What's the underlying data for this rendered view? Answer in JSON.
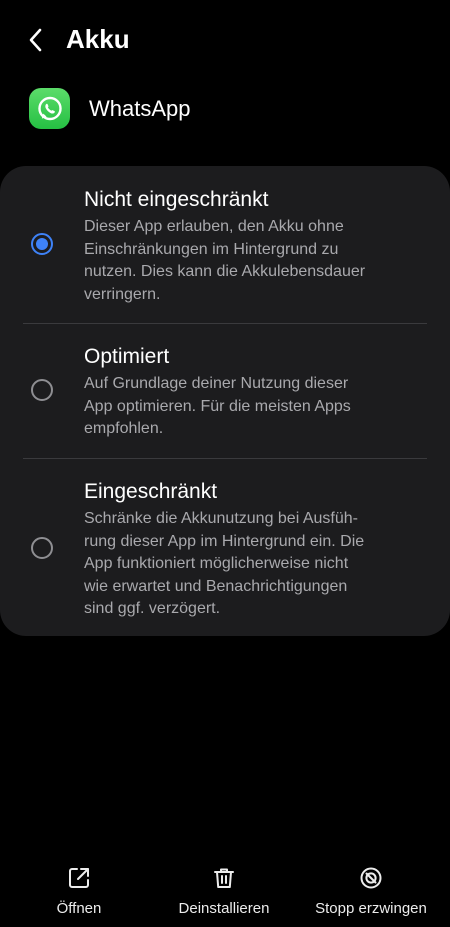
{
  "header": {
    "title": "Akku",
    "back_icon": "chevron-left-icon"
  },
  "app": {
    "name": "WhatsApp",
    "icon": "whatsapp-logo-icon",
    "icon_color": "#25C043"
  },
  "battery_options": [
    {
      "title": "Nicht eingeschränkt",
      "description": [
        "Dieser App erlauben, den Akku ohne",
        "Einschränkungen im Hintergrund zu",
        "nutzen. Dies kann die Akkulebensdauer",
        "verringern."
      ],
      "selected": true
    },
    {
      "title": "Optimiert",
      "description": [
        "Auf Grundlage deiner Nutzung dieser",
        "App optimieren. Für die meisten Apps",
        "empfohlen."
      ],
      "selected": false
    },
    {
      "title": "Eingeschränkt",
      "description": [
        "Schränke die Akkunutzung bei Ausfüh-",
        "rung dieser App im Hintergrund ein. Die",
        "App funktioniert möglicherweise nicht",
        "wie erwartet und Benachrichtigungen",
        "sind ggf. verzögert."
      ],
      "selected": false
    }
  ],
  "accent_color": "#3E82F7",
  "bottom_actions": [
    {
      "label": "Öffnen",
      "icon": "open-external-icon"
    },
    {
      "label": "Deinstallieren",
      "icon": "trash-icon"
    },
    {
      "label": "Stopp erzwingen",
      "icon": "force-stop-icon"
    }
  ]
}
